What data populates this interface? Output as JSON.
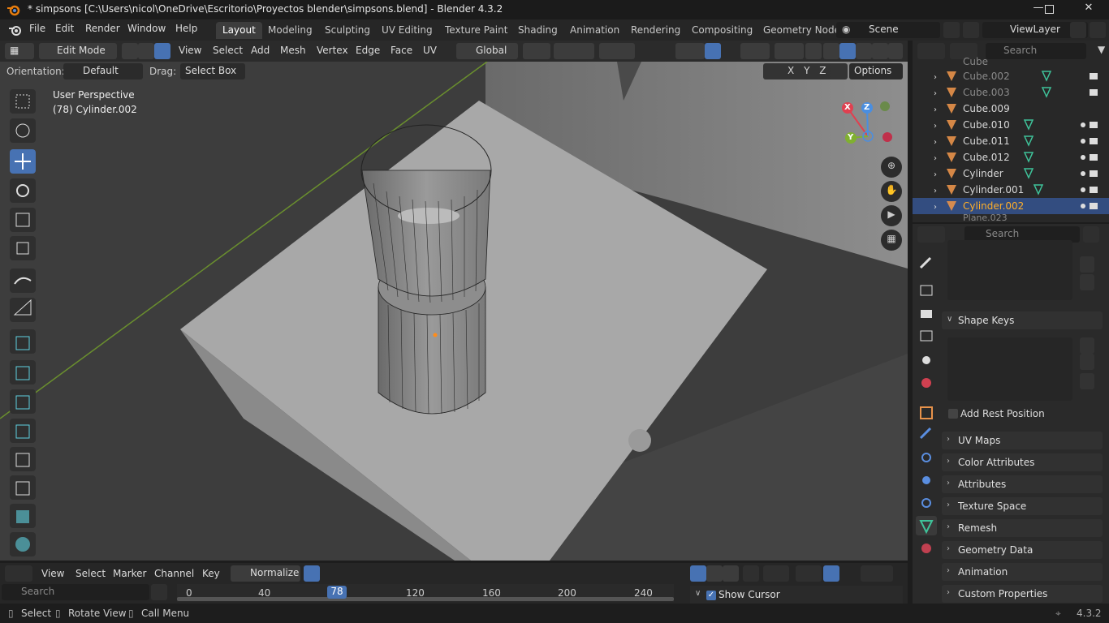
{
  "window": {
    "title": "* simpsons [C:\\Users\\nicol\\OneDrive\\Escritorio\\Proyectos blender\\simpsons.blend] - Blender 4.3.2"
  },
  "menu": [
    "File",
    "Edit",
    "Render",
    "Window",
    "Help"
  ],
  "workspaces": [
    "Layout",
    "Modeling",
    "Sculpting",
    "UV Editing",
    "Texture Paint",
    "Shading",
    "Animation",
    "Rendering",
    "Compositing",
    "Geometry Node"
  ],
  "scene": {
    "name": "Scene",
    "view_layer": "ViewLayer"
  },
  "header": {
    "mode": "Edit Mode",
    "menus": [
      "View",
      "Select",
      "Add",
      "Mesh",
      "Vertex",
      "Edge",
      "Face",
      "UV"
    ],
    "transform": "Global",
    "orientation_label": "Orientation:",
    "orientation_value": "Default",
    "drag_label": "Drag:",
    "drag_value": "Select Box",
    "options": "Options",
    "axes": [
      "X",
      "Y",
      "Z"
    ]
  },
  "viewport": {
    "perspective": "User Perspective",
    "object": "(78) Cylinder.002",
    "gizmo": {
      "x": "X",
      "y": "Y",
      "z": "Z"
    }
  },
  "outliner": {
    "search_placeholder": "Search",
    "items": [
      {
        "name": "Cube",
        "dim": true
      },
      {
        "name": "Cube.002",
        "dim": true
      },
      {
        "name": "Cube.003",
        "dim": true
      },
      {
        "name": "Cube.009",
        "dim": false
      },
      {
        "name": "Cube.010",
        "dim": false
      },
      {
        "name": "Cube.011",
        "dim": false
      },
      {
        "name": "Cube.012",
        "dim": false
      },
      {
        "name": "Cylinder",
        "dim": false
      },
      {
        "name": "Cylinder.001",
        "dim": false
      },
      {
        "name": "Cylinder.002",
        "dim": false,
        "selected": true
      },
      {
        "name": "Plane.023",
        "dim": true
      }
    ]
  },
  "properties": {
    "search_placeholder": "Search",
    "shape_keys": "Shape Keys",
    "add_rest_position": "Add Rest Position",
    "panels": [
      "UV Maps",
      "Color Attributes",
      "Attributes",
      "Texture Space",
      "Remesh",
      "Geometry Data",
      "Animation",
      "Custom Properties"
    ]
  },
  "timeline": {
    "menus": [
      "View",
      "Select",
      "Marker",
      "Channel",
      "Key"
    ],
    "normalize": "Normalize",
    "search_placeholder": "Search",
    "current_frame": "78",
    "ticks": [
      "0",
      "40",
      "120",
      "160",
      "200",
      "240"
    ],
    "show_cursor": "Show Cursor"
  },
  "status": {
    "items": [
      "Select",
      "Rotate View",
      "Call Menu"
    ],
    "version": "4.3.2"
  },
  "colors": {
    "accent": "#4772b3",
    "selected_text": "#ffaf29",
    "mesh_icon": "#3fc39a",
    "object_icon": "#e8924a"
  }
}
